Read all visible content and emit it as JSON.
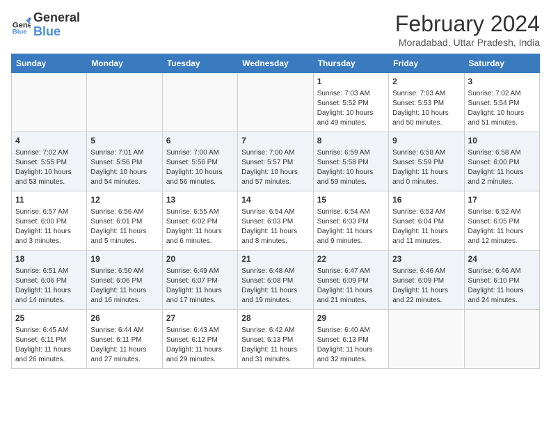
{
  "header": {
    "logo_line1": "General",
    "logo_line2": "Blue",
    "month": "February 2024",
    "location": "Moradabad, Uttar Pradesh, India"
  },
  "weekdays": [
    "Sunday",
    "Monday",
    "Tuesday",
    "Wednesday",
    "Thursday",
    "Friday",
    "Saturday"
  ],
  "weeks": [
    [
      {
        "day": "",
        "info": ""
      },
      {
        "day": "",
        "info": ""
      },
      {
        "day": "",
        "info": ""
      },
      {
        "day": "",
        "info": ""
      },
      {
        "day": "1",
        "info": "Sunrise: 7:03 AM\nSunset: 5:52 PM\nDaylight: 10 hours\nand 49 minutes."
      },
      {
        "day": "2",
        "info": "Sunrise: 7:03 AM\nSunset: 5:53 PM\nDaylight: 10 hours\nand 50 minutes."
      },
      {
        "day": "3",
        "info": "Sunrise: 7:02 AM\nSunset: 5:54 PM\nDaylight: 10 hours\nand 51 minutes."
      }
    ],
    [
      {
        "day": "4",
        "info": "Sunrise: 7:02 AM\nSunset: 5:55 PM\nDaylight: 10 hours\nand 53 minutes."
      },
      {
        "day": "5",
        "info": "Sunrise: 7:01 AM\nSunset: 5:56 PM\nDaylight: 10 hours\nand 54 minutes."
      },
      {
        "day": "6",
        "info": "Sunrise: 7:00 AM\nSunset: 5:56 PM\nDaylight: 10 hours\nand 56 minutes."
      },
      {
        "day": "7",
        "info": "Sunrise: 7:00 AM\nSunset: 5:57 PM\nDaylight: 10 hours\nand 57 minutes."
      },
      {
        "day": "8",
        "info": "Sunrise: 6:59 AM\nSunset: 5:58 PM\nDaylight: 10 hours\nand 59 minutes."
      },
      {
        "day": "9",
        "info": "Sunrise: 6:58 AM\nSunset: 5:59 PM\nDaylight: 11 hours\nand 0 minutes."
      },
      {
        "day": "10",
        "info": "Sunrise: 6:58 AM\nSunset: 6:00 PM\nDaylight: 11 hours\nand 2 minutes."
      }
    ],
    [
      {
        "day": "11",
        "info": "Sunrise: 6:57 AM\nSunset: 6:00 PM\nDaylight: 11 hours\nand 3 minutes."
      },
      {
        "day": "12",
        "info": "Sunrise: 6:56 AM\nSunset: 6:01 PM\nDaylight: 11 hours\nand 5 minutes."
      },
      {
        "day": "13",
        "info": "Sunrise: 6:55 AM\nSunset: 6:02 PM\nDaylight: 11 hours\nand 6 minutes."
      },
      {
        "day": "14",
        "info": "Sunrise: 6:54 AM\nSunset: 6:03 PM\nDaylight: 11 hours\nand 8 minutes."
      },
      {
        "day": "15",
        "info": "Sunrise: 6:54 AM\nSunset: 6:03 PM\nDaylight: 11 hours\nand 9 minutes."
      },
      {
        "day": "16",
        "info": "Sunrise: 6:53 AM\nSunset: 6:04 PM\nDaylight: 11 hours\nand 11 minutes."
      },
      {
        "day": "17",
        "info": "Sunrise: 6:52 AM\nSunset: 6:05 PM\nDaylight: 11 hours\nand 12 minutes."
      }
    ],
    [
      {
        "day": "18",
        "info": "Sunrise: 6:51 AM\nSunset: 6:06 PM\nDaylight: 11 hours\nand 14 minutes."
      },
      {
        "day": "19",
        "info": "Sunrise: 6:50 AM\nSunset: 6:06 PM\nDaylight: 11 hours\nand 16 minutes."
      },
      {
        "day": "20",
        "info": "Sunrise: 6:49 AM\nSunset: 6:07 PM\nDaylight: 11 hours\nand 17 minutes."
      },
      {
        "day": "21",
        "info": "Sunrise: 6:48 AM\nSunset: 6:08 PM\nDaylight: 11 hours\nand 19 minutes."
      },
      {
        "day": "22",
        "info": "Sunrise: 6:47 AM\nSunset: 6:09 PM\nDaylight: 11 hours\nand 21 minutes."
      },
      {
        "day": "23",
        "info": "Sunrise: 6:46 AM\nSunset: 6:09 PM\nDaylight: 11 hours\nand 22 minutes."
      },
      {
        "day": "24",
        "info": "Sunrise: 6:46 AM\nSunset: 6:10 PM\nDaylight: 11 hours\nand 24 minutes."
      }
    ],
    [
      {
        "day": "25",
        "info": "Sunrise: 6:45 AM\nSunset: 6:11 PM\nDaylight: 11 hours\nand 26 minutes."
      },
      {
        "day": "26",
        "info": "Sunrise: 6:44 AM\nSunset: 6:11 PM\nDaylight: 11 hours\nand 27 minutes."
      },
      {
        "day": "27",
        "info": "Sunrise: 6:43 AM\nSunset: 6:12 PM\nDaylight: 11 hours\nand 29 minutes."
      },
      {
        "day": "28",
        "info": "Sunrise: 6:42 AM\nSunset: 6:13 PM\nDaylight: 11 hours\nand 31 minutes."
      },
      {
        "day": "29",
        "info": "Sunrise: 6:40 AM\nSunset: 6:13 PM\nDaylight: 11 hours\nand 32 minutes."
      },
      {
        "day": "",
        "info": ""
      },
      {
        "day": "",
        "info": ""
      }
    ]
  ]
}
